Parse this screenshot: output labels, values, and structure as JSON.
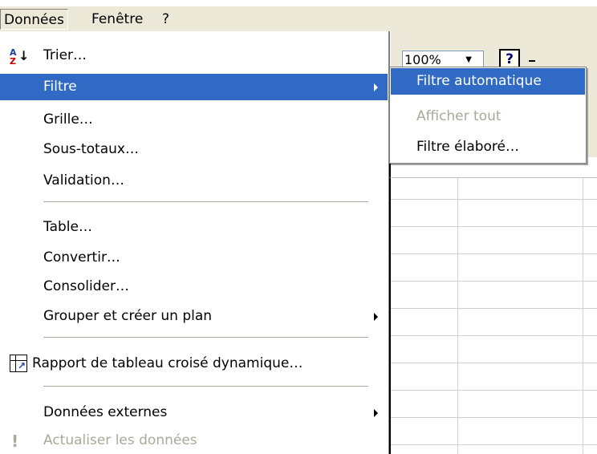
{
  "menubar": {
    "donnees": "Données",
    "fenetre": "Fenêtre",
    "aide": "?"
  },
  "toolbar": {
    "zoom": "100%",
    "help": "?"
  },
  "menu": {
    "trier": "Trier…",
    "filtre": "Filtre",
    "grille": "Grille…",
    "sous_totaux": "Sous-totaux…",
    "validation": "Validation…",
    "table": "Table…",
    "convertir": "Convertir…",
    "consolider": "Consolider…",
    "grouper": "Grouper et créer un plan",
    "rapport": "Rapport de tableau croisé dynamique…",
    "donnees_externes": "Données externes",
    "actualiser": "Actualiser les données"
  },
  "submenu": {
    "filtre_auto": "Filtre automatique",
    "afficher_tout": "Afficher tout",
    "filtre_elabore": "Filtre élaboré…"
  },
  "colors": {
    "highlight": "#316ac5",
    "menubar": "#ece9d8",
    "disabled": "#aca899"
  },
  "icons": {
    "sort": "sort-az-icon",
    "pivot": "pivot-table-icon",
    "refresh": "refresh-data-icon",
    "submenu_arrow": "submenu-arrow-icon",
    "dropdown_arrow": "chevron-down-icon"
  }
}
